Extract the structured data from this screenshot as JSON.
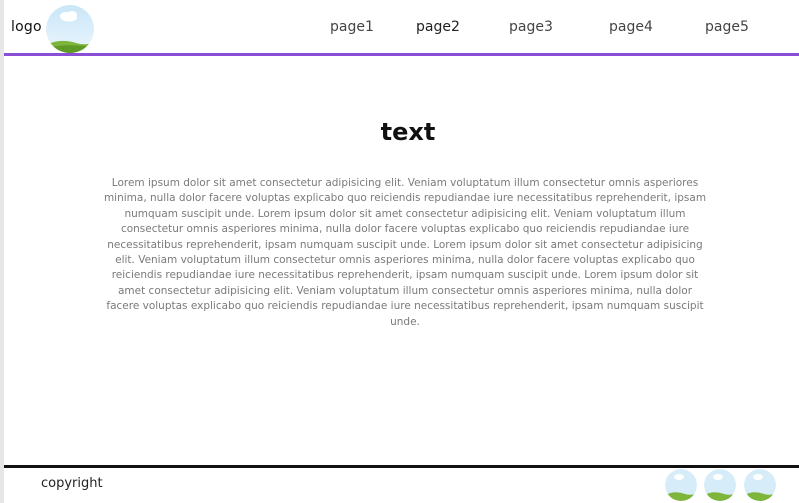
{
  "header": {
    "logo_text": "logo",
    "nav": [
      "page1",
      "page2",
      "page3",
      "page4",
      "page5"
    ]
  },
  "main": {
    "title": "text",
    "body": "Lorem ipsum dolor sit amet consectetur adipisicing elit. Veniam voluptatum illum consectetur omnis asperiores minima, nulla dolor facere voluptas explicabo quo reiciendis repudiandae iure necessitatibus reprehenderit, ipsam numquam suscipit unde. Lorem ipsum dolor sit amet consectetur adipisicing elit. Veniam voluptatum illum consectetur omnis asperiores minima, nulla dolor facere voluptas explicabo quo reiciendis repudiandae iure necessitatibus reprehenderit, ipsam numquam suscipit unde. Lorem ipsum dolor sit amet consectetur adipisicing elit. Veniam voluptatum illum consectetur omnis asperiores minima, nulla dolor facere voluptas explicabo quo reiciendis repudiandae iure necessitatibus reprehenderit, ipsam numquam suscipit unde. Lorem ipsum dolor sit amet consectetur adipisicing elit. Veniam voluptatum illum consectetur omnis asperiores minima, nulla dolor facere voluptas explicabo quo reiciendis repudiandae iure necessitatibus reprehenderit, ipsam numquam suscipit unde."
  },
  "footer": {
    "copyright": "copyright"
  },
  "colors": {
    "header_border": "#8a4fd6",
    "footer_border": "#111111",
    "body_text": "#7a7a7a",
    "sky": "#d9eefb",
    "grass": "#7db63a"
  },
  "icons": {
    "logo": "landscape-image-icon",
    "footer": [
      "landscape-image-icon",
      "landscape-image-icon",
      "landscape-image-icon"
    ]
  }
}
